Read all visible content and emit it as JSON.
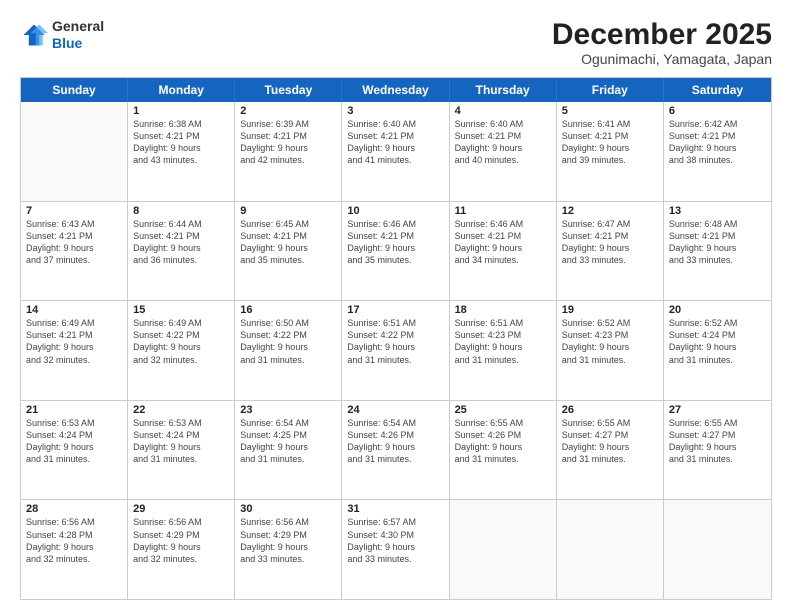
{
  "header": {
    "logo_line1": "General",
    "logo_line2": "Blue",
    "month": "December 2025",
    "location": "Ogunimachi, Yamagata, Japan"
  },
  "weekdays": [
    "Sunday",
    "Monday",
    "Tuesday",
    "Wednesday",
    "Thursday",
    "Friday",
    "Saturday"
  ],
  "rows": [
    [
      {
        "day": "",
        "sunrise": "",
        "sunset": "",
        "daylight": ""
      },
      {
        "day": "1",
        "sunrise": "Sunrise: 6:38 AM",
        "sunset": "Sunset: 4:21 PM",
        "daylight": "Daylight: 9 hours",
        "daylight2": "and 43 minutes."
      },
      {
        "day": "2",
        "sunrise": "Sunrise: 6:39 AM",
        "sunset": "Sunset: 4:21 PM",
        "daylight": "Daylight: 9 hours",
        "daylight2": "and 42 minutes."
      },
      {
        "day": "3",
        "sunrise": "Sunrise: 6:40 AM",
        "sunset": "Sunset: 4:21 PM",
        "daylight": "Daylight: 9 hours",
        "daylight2": "and 41 minutes."
      },
      {
        "day": "4",
        "sunrise": "Sunrise: 6:40 AM",
        "sunset": "Sunset: 4:21 PM",
        "daylight": "Daylight: 9 hours",
        "daylight2": "and 40 minutes."
      },
      {
        "day": "5",
        "sunrise": "Sunrise: 6:41 AM",
        "sunset": "Sunset: 4:21 PM",
        "daylight": "Daylight: 9 hours",
        "daylight2": "and 39 minutes."
      },
      {
        "day": "6",
        "sunrise": "Sunrise: 6:42 AM",
        "sunset": "Sunset: 4:21 PM",
        "daylight": "Daylight: 9 hours",
        "daylight2": "and 38 minutes."
      }
    ],
    [
      {
        "day": "7",
        "sunrise": "Sunrise: 6:43 AM",
        "sunset": "Sunset: 4:21 PM",
        "daylight": "Daylight: 9 hours",
        "daylight2": "and 37 minutes."
      },
      {
        "day": "8",
        "sunrise": "Sunrise: 6:44 AM",
        "sunset": "Sunset: 4:21 PM",
        "daylight": "Daylight: 9 hours",
        "daylight2": "and 36 minutes."
      },
      {
        "day": "9",
        "sunrise": "Sunrise: 6:45 AM",
        "sunset": "Sunset: 4:21 PM",
        "daylight": "Daylight: 9 hours",
        "daylight2": "and 35 minutes."
      },
      {
        "day": "10",
        "sunrise": "Sunrise: 6:46 AM",
        "sunset": "Sunset: 4:21 PM",
        "daylight": "Daylight: 9 hours",
        "daylight2": "and 35 minutes."
      },
      {
        "day": "11",
        "sunrise": "Sunrise: 6:46 AM",
        "sunset": "Sunset: 4:21 PM",
        "daylight": "Daylight: 9 hours",
        "daylight2": "and 34 minutes."
      },
      {
        "day": "12",
        "sunrise": "Sunrise: 6:47 AM",
        "sunset": "Sunset: 4:21 PM",
        "daylight": "Daylight: 9 hours",
        "daylight2": "and 33 minutes."
      },
      {
        "day": "13",
        "sunrise": "Sunrise: 6:48 AM",
        "sunset": "Sunset: 4:21 PM",
        "daylight": "Daylight: 9 hours",
        "daylight2": "and 33 minutes."
      }
    ],
    [
      {
        "day": "14",
        "sunrise": "Sunrise: 6:49 AM",
        "sunset": "Sunset: 4:21 PM",
        "daylight": "Daylight: 9 hours",
        "daylight2": "and 32 minutes."
      },
      {
        "day": "15",
        "sunrise": "Sunrise: 6:49 AM",
        "sunset": "Sunset: 4:22 PM",
        "daylight": "Daylight: 9 hours",
        "daylight2": "and 32 minutes."
      },
      {
        "day": "16",
        "sunrise": "Sunrise: 6:50 AM",
        "sunset": "Sunset: 4:22 PM",
        "daylight": "Daylight: 9 hours",
        "daylight2": "and 31 minutes."
      },
      {
        "day": "17",
        "sunrise": "Sunrise: 6:51 AM",
        "sunset": "Sunset: 4:22 PM",
        "daylight": "Daylight: 9 hours",
        "daylight2": "and 31 minutes."
      },
      {
        "day": "18",
        "sunrise": "Sunrise: 6:51 AM",
        "sunset": "Sunset: 4:23 PM",
        "daylight": "Daylight: 9 hours",
        "daylight2": "and 31 minutes."
      },
      {
        "day": "19",
        "sunrise": "Sunrise: 6:52 AM",
        "sunset": "Sunset: 4:23 PM",
        "daylight": "Daylight: 9 hours",
        "daylight2": "and 31 minutes."
      },
      {
        "day": "20",
        "sunrise": "Sunrise: 6:52 AM",
        "sunset": "Sunset: 4:24 PM",
        "daylight": "Daylight: 9 hours",
        "daylight2": "and 31 minutes."
      }
    ],
    [
      {
        "day": "21",
        "sunrise": "Sunrise: 6:53 AM",
        "sunset": "Sunset: 4:24 PM",
        "daylight": "Daylight: 9 hours",
        "daylight2": "and 31 minutes."
      },
      {
        "day": "22",
        "sunrise": "Sunrise: 6:53 AM",
        "sunset": "Sunset: 4:24 PM",
        "daylight": "Daylight: 9 hours",
        "daylight2": "and 31 minutes."
      },
      {
        "day": "23",
        "sunrise": "Sunrise: 6:54 AM",
        "sunset": "Sunset: 4:25 PM",
        "daylight": "Daylight: 9 hours",
        "daylight2": "and 31 minutes."
      },
      {
        "day": "24",
        "sunrise": "Sunrise: 6:54 AM",
        "sunset": "Sunset: 4:26 PM",
        "daylight": "Daylight: 9 hours",
        "daylight2": "and 31 minutes."
      },
      {
        "day": "25",
        "sunrise": "Sunrise: 6:55 AM",
        "sunset": "Sunset: 4:26 PM",
        "daylight": "Daylight: 9 hours",
        "daylight2": "and 31 minutes."
      },
      {
        "day": "26",
        "sunrise": "Sunrise: 6:55 AM",
        "sunset": "Sunset: 4:27 PM",
        "daylight": "Daylight: 9 hours",
        "daylight2": "and 31 minutes."
      },
      {
        "day": "27",
        "sunrise": "Sunrise: 6:55 AM",
        "sunset": "Sunset: 4:27 PM",
        "daylight": "Daylight: 9 hours",
        "daylight2": "and 31 minutes."
      }
    ],
    [
      {
        "day": "28",
        "sunrise": "Sunrise: 6:56 AM",
        "sunset": "Sunset: 4:28 PM",
        "daylight": "Daylight: 9 hours",
        "daylight2": "and 32 minutes."
      },
      {
        "day": "29",
        "sunrise": "Sunrise: 6:56 AM",
        "sunset": "Sunset: 4:29 PM",
        "daylight": "Daylight: 9 hours",
        "daylight2": "and 32 minutes."
      },
      {
        "day": "30",
        "sunrise": "Sunrise: 6:56 AM",
        "sunset": "Sunset: 4:29 PM",
        "daylight": "Daylight: 9 hours",
        "daylight2": "and 33 minutes."
      },
      {
        "day": "31",
        "sunrise": "Sunrise: 6:57 AM",
        "sunset": "Sunset: 4:30 PM",
        "daylight": "Daylight: 9 hours",
        "daylight2": "and 33 minutes."
      },
      {
        "day": "",
        "sunrise": "",
        "sunset": "",
        "daylight": "",
        "daylight2": ""
      },
      {
        "day": "",
        "sunrise": "",
        "sunset": "",
        "daylight": "",
        "daylight2": ""
      },
      {
        "day": "",
        "sunrise": "",
        "sunset": "",
        "daylight": "",
        "daylight2": ""
      }
    ]
  ]
}
